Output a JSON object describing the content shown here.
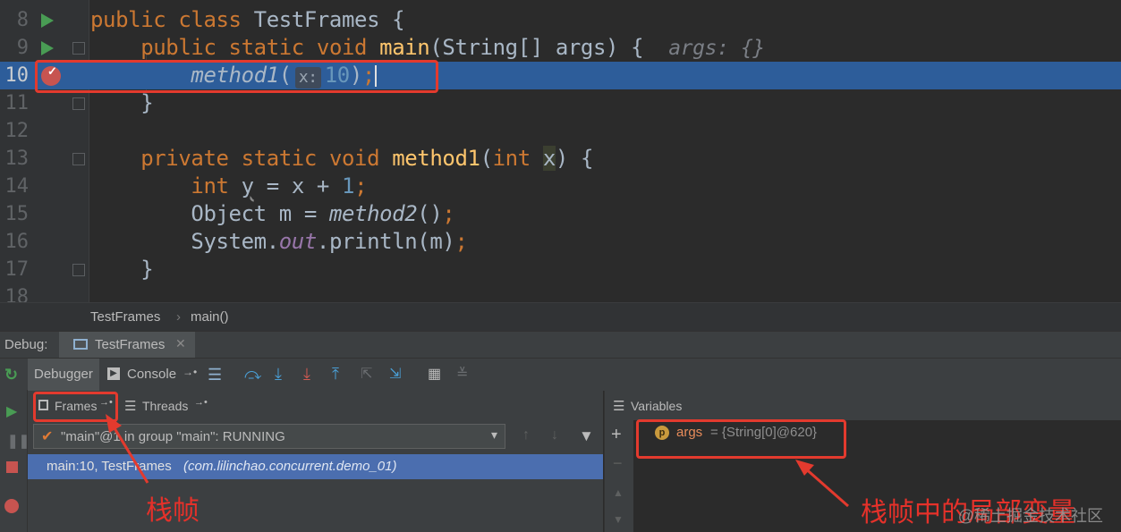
{
  "editor": {
    "lines": [
      {
        "num": "8"
      },
      {
        "num": "9",
        "hint": "args: {}"
      },
      {
        "num": "10",
        "param_hint": "x:",
        "arg": "10"
      },
      {
        "num": "11"
      },
      {
        "num": "12"
      },
      {
        "num": "13"
      },
      {
        "num": "14"
      },
      {
        "num": "15"
      },
      {
        "num": "16"
      },
      {
        "num": "17"
      },
      {
        "num": "18"
      }
    ]
  },
  "breadcrumb": {
    "items": [
      "TestFrames",
      "main()"
    ]
  },
  "debug": {
    "label": "Debug:",
    "session_tab": "TestFrames",
    "tabs": {
      "debugger": "Debugger",
      "console": "Console"
    },
    "frames_tab": "Frames",
    "threads_tab": "Threads",
    "thread_combo": "\"main\"@1 in group \"main\": RUNNING",
    "frame_location": "main:10, TestFrames",
    "frame_package": "(com.lilinchao.concurrent.demo_01)",
    "variables_title": "Variables",
    "variable": {
      "badge": "p",
      "name": "args",
      "value": "= {String[0]@620}"
    }
  },
  "annotations": {
    "frames_label": "栈帧",
    "vars_label": "栈帧中的局部变量"
  },
  "watermark": "@稀土掘金技术社区",
  "colors": {
    "accent_red": "#e33a2e",
    "selected_row": "#4b6eaf",
    "current_line": "#2d5d9a"
  }
}
